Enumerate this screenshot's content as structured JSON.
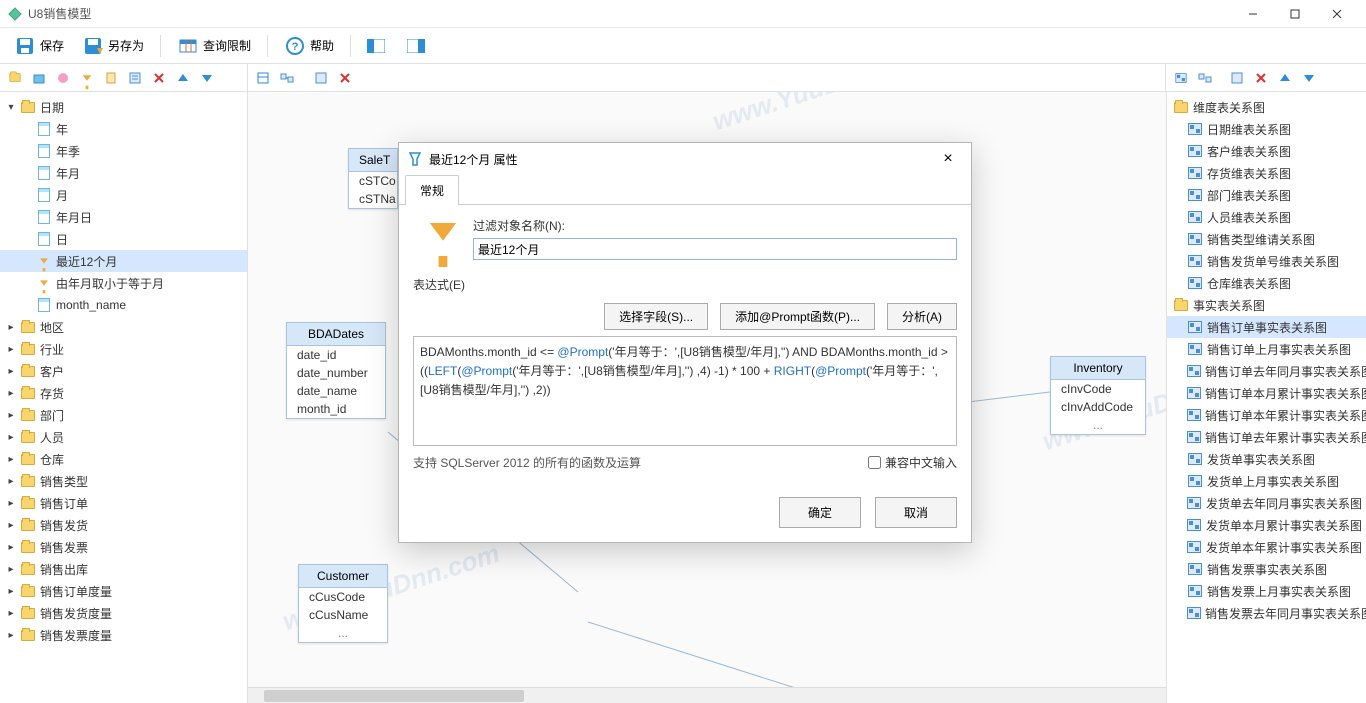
{
  "app": {
    "title": "U8销售模型"
  },
  "toolbar": {
    "save": "保存",
    "saveas": "另存为",
    "querylimit": "查询限制",
    "help": "帮助"
  },
  "leftTree": {
    "root": "日期",
    "children": [
      "年",
      "年季",
      "年月",
      "月",
      "年月日",
      "日"
    ],
    "filter1": "最近12个月",
    "filter2": "由年月取小于等于月",
    "monthname": "month_name",
    "folders": [
      "地区",
      "行业",
      "客户",
      "存货",
      "部门",
      "人员",
      "仓库",
      "销售类型",
      "销售订单",
      "销售发货",
      "销售发票",
      "销售出库",
      "销售订单度量",
      "销售发货度量",
      "销售发票度量"
    ]
  },
  "rightTree": {
    "group1": "维度表关系图",
    "items1": [
      "日期维表关系图",
      "客户维表关系图",
      "存货维表关系图",
      "部门维表关系图",
      "人员维表关系图",
      "销售类型维请关系图",
      "销售发货单号维表关系图",
      "仓库维表关系图"
    ],
    "group2": "事实表关系图",
    "items2": [
      "销售订单事实表关系图",
      "销售订单上月事实表关系图",
      "销售订单去年同月事实表关系图",
      "销售订单本月累计事实表关系图",
      "销售订单本年累计事实表关系图",
      "销售订单去年累计事实表关系图",
      "发货单事实表关系图",
      "发货单上月事实表关系图",
      "发货单去年同月事实表关系图",
      "发货单本月累计事实表关系图",
      "发货单本年累计事实表关系图",
      "销售发票事实表关系图",
      "销售发票上月事实表关系图",
      "销售发票去年同月事实表关系图"
    ],
    "selectedIndex2": 0
  },
  "canvas": {
    "watermark": "www.YuuDnn.com",
    "tables": {
      "salet": {
        "title": "SaleT",
        "cols": [
          "cSTCo",
          "cSTNa"
        ]
      },
      "dates": {
        "title": "BDADates",
        "cols": [
          "date_id",
          "date_number",
          "date_name",
          "month_id"
        ]
      },
      "customer": {
        "title": "Customer",
        "cols": [
          "cCusCode",
          "cCusName",
          "..."
        ]
      },
      "inventory": {
        "title": "Inventory",
        "cols": [
          "cInvCode",
          "cInvAddCode",
          "..."
        ]
      }
    }
  },
  "dialog": {
    "title": "最近12个月 属性",
    "tab": "常规",
    "name_label": "过滤对象名称(N):",
    "name_value": "最近12个月",
    "expr_label": "表达式(E)",
    "btn_select": "选择字段(S)...",
    "btn_prompt": "添加@Prompt函数(P)...",
    "btn_analyze": "分析(A)",
    "expression_plain": "BDAMonths.month_id <= @Prompt('年月等于：',[U8销售模型/年月],'') AND BDAMonths.month_id > ((LEFT(@Prompt('年月等于：',[U8销售模型/年月],'') ,4) -1) * 100 + RIGHT(@Prompt('年月等于：',[U8销售模型/年月],'') ,2))",
    "support": "支持 SQLServer 2012 的所有的函数及运算",
    "cncompat": "兼容中文输入",
    "ok": "确定",
    "cancel": "取消"
  }
}
